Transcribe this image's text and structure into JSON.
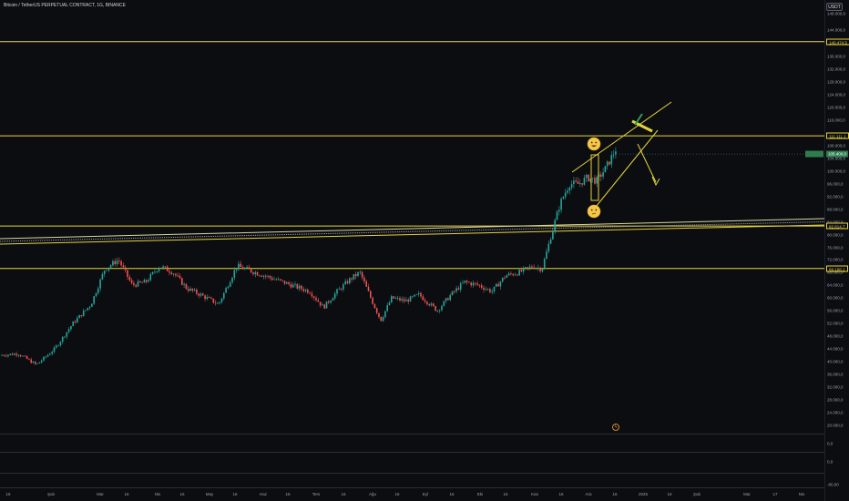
{
  "header": {
    "title": "Bitcoin / TetherUS PERPETUAL CONTRACT, 1G, BINANCE",
    "currency": "USDT"
  },
  "price_axis": {
    "labels": [
      "148.000,0",
      "144.000,0",
      "136.000,0",
      "132.000,0",
      "128.000,0",
      "124.000,0",
      "120.000,0",
      "116.000,0",
      "108.000,0",
      "104.000,0",
      "100.000,0",
      "96.000,0",
      "92.000,0",
      "88.000,0",
      "84.000,0",
      "80.000,0",
      "76.000,0",
      "72.000,0",
      "68.000,0",
      "64.000,0",
      "60.000,0",
      "56.000,0",
      "52.000,0",
      "48.000,0",
      "44.000,0",
      "40.000,0",
      "36.000,0",
      "32.000,0",
      "28.000,0",
      "24.000,0",
      "20.000,0"
    ],
    "values": [
      148000,
      144000,
      136000,
      132000,
      128000,
      124000,
      120000,
      116000,
      108000,
      104000,
      100000,
      96000,
      92000,
      88000,
      84000,
      80000,
      76000,
      72000,
      68000,
      64000,
      60000,
      56000,
      52000,
      48000,
      44000,
      40000,
      36000,
      32000,
      28000,
      24000,
      20000
    ]
  },
  "horizontal_levels": [
    {
      "label": "140.474,5",
      "value": 140474.5
    },
    {
      "label": "111.111,1",
      "value": 111111.1
    },
    {
      "label": "82.814,7",
      "value": 82814.7
    },
    {
      "label": "69.198,1",
      "value": 69198.1
    }
  ],
  "current_price": {
    "label": "105.400,0",
    "value": 105400
  },
  "time_axis": {
    "labels": [
      "16",
      "Şub",
      "Mar",
      "16",
      "Nis",
      "16",
      "May",
      "16",
      "Haz",
      "16",
      "Tem",
      "16",
      "Ağu",
      "16",
      "Eyl",
      "16",
      "Eki",
      "16",
      "Kas",
      "16",
      "Ara",
      "16",
      "2025",
      "16",
      "Şub",
      "Mar",
      "17",
      "Nis"
    ]
  },
  "sub_panels": [
    {
      "label": "0,0"
    },
    {
      "label": "0,0"
    },
    {
      "label": "-80,00"
    }
  ],
  "colors": {
    "background": "#0c0d11",
    "up": "#26a69a",
    "down": "#ef5350",
    "level": "#e6d33c",
    "grid": "#1a1d24"
  },
  "icons": {
    "happy_emoji": "smiling-face-icon",
    "worried_emoji": "thinking-face-icon",
    "replay": "lightning-icon"
  }
}
